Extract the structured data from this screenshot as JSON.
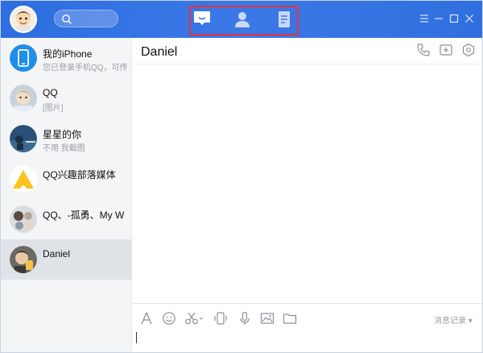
{
  "app": {
    "colors": {
      "titlebar": "#3473e4",
      "highlight": "#e8333f",
      "icon_blue": "#1f8ee8"
    }
  },
  "header": {
    "search_icon": "search-icon",
    "nav": [
      {
        "name": "messages-tab",
        "icon": "chat-bubble-icon"
      },
      {
        "name": "contacts-tab",
        "icon": "person-icon"
      },
      {
        "name": "space-tab",
        "icon": "document-icon"
      }
    ],
    "window_controls": [
      "menu-icon",
      "minimize-icon",
      "maximize-icon",
      "close-icon"
    ]
  },
  "conversations": [
    {
      "name": "我的iPhone",
      "preview": "您已登录手机QQ，可传",
      "avatar": "phone-avatar"
    },
    {
      "name": "QQ",
      "preview": "[图片]",
      "avatar": "baby-avatar"
    },
    {
      "name": "星星的你",
      "preview": "不用 我截图",
      "avatar": "landscape-avatar"
    },
    {
      "name": "QQ兴趣部落媒体",
      "preview": "",
      "avatar": "tribe-avatar"
    },
    {
      "name": "QQ、-孤勇、My W",
      "preview": "",
      "avatar": "group-avatar"
    },
    {
      "name": "Daniel",
      "preview": "",
      "avatar": "daniel-avatar",
      "active": true
    }
  ],
  "chat": {
    "title": "Daniel",
    "actions": [
      "phone-icon",
      "add-member-icon",
      "settings-icon"
    ]
  },
  "toolbar": {
    "tools": [
      "font-icon",
      "emoji-icon",
      "screenshot-icon",
      "shake-icon",
      "voice-icon",
      "image-icon",
      "folder-icon"
    ],
    "history_label": "消息记录 ▾"
  }
}
